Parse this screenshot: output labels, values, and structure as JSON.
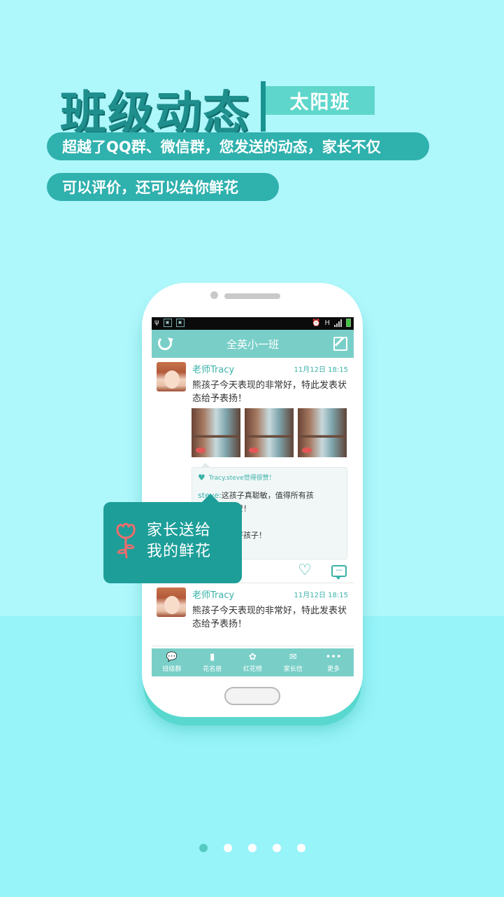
{
  "hero": {
    "title": "班级动态",
    "tag": "太阳班",
    "line1": "超越了QQ群、微信群，您发送的动态，家长不仅",
    "line2": "可以评价，还可以给你鲜花"
  },
  "app": {
    "title": "全英小一班",
    "status_network": "H",
    "tabs": [
      {
        "label": "班级群",
        "icon": "chat-bubbles-icon"
      },
      {
        "label": "花名册",
        "icon": "book-icon"
      },
      {
        "label": "红花榜",
        "icon": "badge-icon"
      },
      {
        "label": "家长信",
        "icon": "envelope-icon"
      },
      {
        "label": "更多",
        "icon": "more-dots-icon"
      }
    ]
  },
  "posts": [
    {
      "author": "老师Tracy",
      "time": "11月12日  18:15",
      "content": "熊孩子今天表现的非常好，特此发表状态给予表扬！",
      "likes": "Tracy.steve觉得很赞！",
      "comments": [
        {
          "who": "steve:",
          "text": "这孩子真聪敏，值得所有孩"
        },
        {
          "who": "",
          "text": "赞！"
        },
        {
          "who": "",
          "text": "！"
        },
        {
          "who": "",
          "text": "好孩子！"
        }
      ]
    },
    {
      "author": "老师Tracy",
      "time": "11月12日  18:15",
      "content": "熊孩子今天表现的非常好，特此发表状态给予表扬！"
    }
  ],
  "callout": {
    "line1": "家长送给",
    "line2": "我的鲜花"
  },
  "colors": {
    "accent": "#79cfc8",
    "accent_dark": "#1d9e99",
    "title": "#1f8f8d",
    "flower": "#ef6c6c"
  },
  "pager": {
    "current": 1,
    "total": 5
  }
}
